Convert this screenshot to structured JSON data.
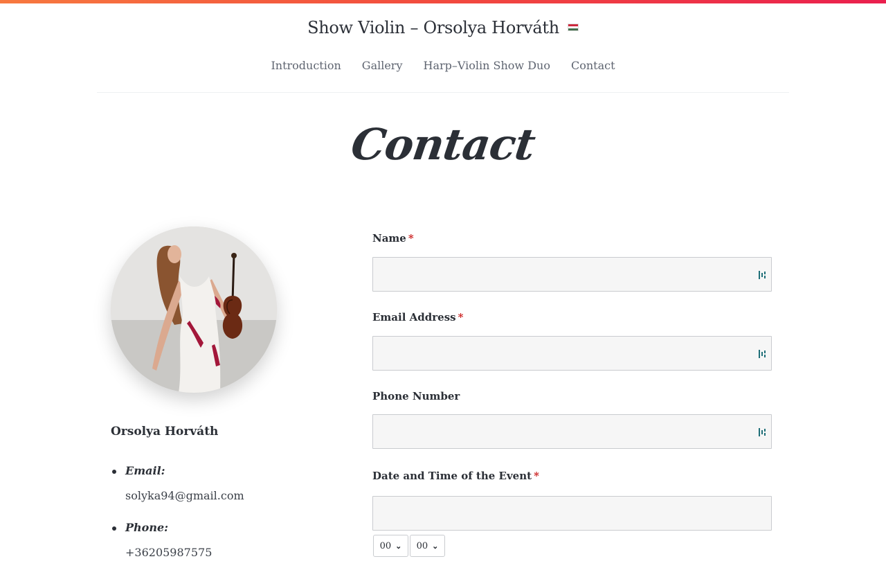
{
  "site": {
    "title": "Show Violin – Orsolya Horváth",
    "language_flag": "hungarian-flag-icon"
  },
  "nav": {
    "items": [
      {
        "label": "Introduction"
      },
      {
        "label": "Gallery"
      },
      {
        "label": "Harp–Violin Show Duo"
      },
      {
        "label": "Contact"
      }
    ]
  },
  "page": {
    "heading": "Contact"
  },
  "profile": {
    "name": "Orsolya Horváth",
    "email_label": "Email:",
    "email_value": "solyka94@gmail.com",
    "phone_label": "Phone:",
    "phone_value": "+36205987575"
  },
  "form": {
    "name_label": "Name",
    "email_label": "Email Address",
    "phone_label": "Phone Number",
    "datetime_label": "Date and Time of the Event",
    "required_mark": "*",
    "hour_value": "00",
    "minute_value": "00"
  },
  "colors": {
    "accent_start": "#f7793f",
    "accent_end": "#ea1f4e",
    "required": "#cc2222",
    "field_bg": "#f6f6f6"
  }
}
